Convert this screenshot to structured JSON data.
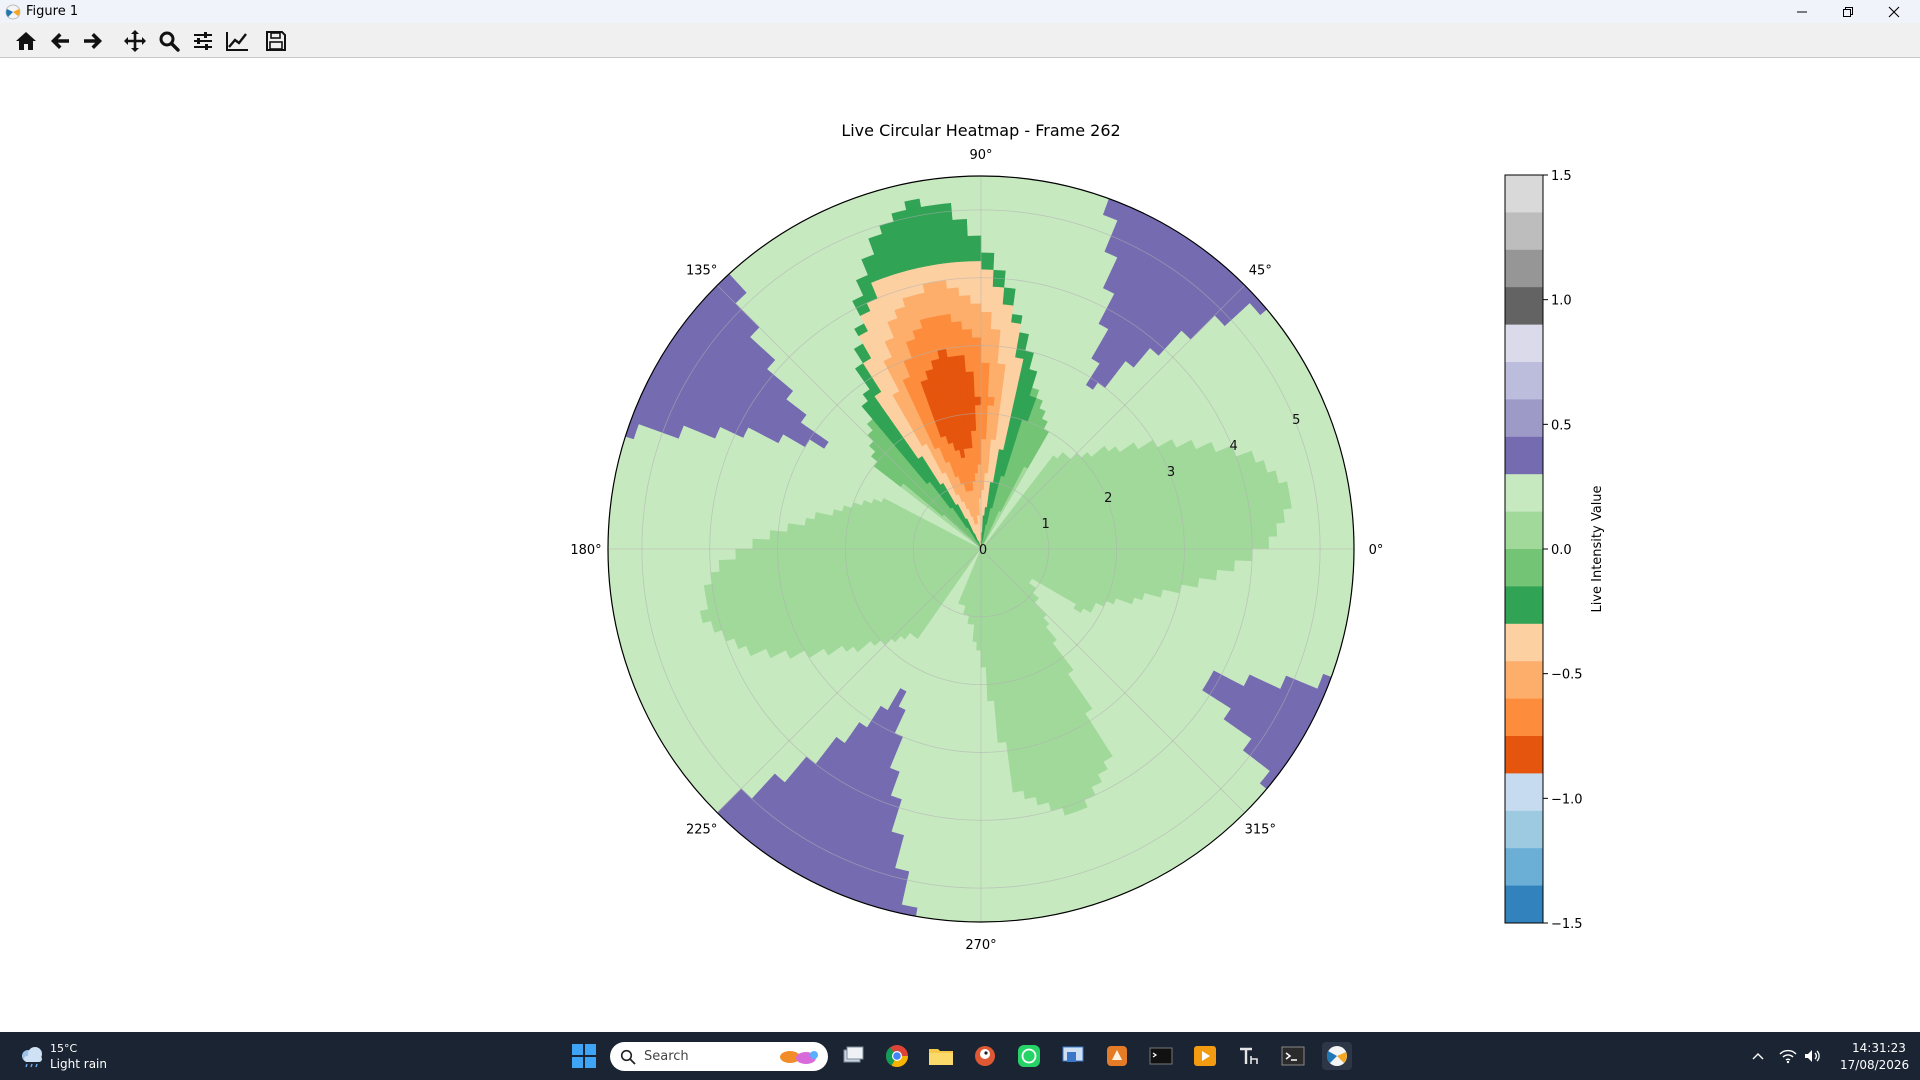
{
  "window": {
    "title": "Figure 1"
  },
  "toolbar": {
    "buttons": [
      {
        "name": "home",
        "icon": "home-icon"
      },
      {
        "name": "back",
        "icon": "arrow-left-icon"
      },
      {
        "name": "forward",
        "icon": "arrow-right-icon"
      },
      {
        "name": "pan",
        "icon": "move-icon"
      },
      {
        "name": "zoom",
        "icon": "magnifier-icon"
      },
      {
        "name": "configure",
        "icon": "sliders-icon"
      },
      {
        "name": "edit-axis",
        "icon": "line-chart-icon"
      },
      {
        "name": "save",
        "icon": "floppy-icon"
      }
    ]
  },
  "chart_data": {
    "type": "heatmap",
    "projection": "polar",
    "title": "Live Circular Heatmap - Frame 262",
    "angle_ticks": [
      "0°",
      "45°",
      "90°",
      "135°",
      "180°",
      "225°",
      "270°",
      "315°"
    ],
    "radial_ticks": [
      "0",
      "1",
      "2",
      "3",
      "4",
      "5"
    ],
    "rlim": [
      0,
      5.5
    ],
    "grid": true,
    "colorbar": {
      "label": "Live Intensity Value",
      "ticks": [
        "1.5",
        "1.0",
        "0.5",
        "0.0",
        "−0.5",
        "−1.0",
        "−1.5"
      ],
      "range": [
        -1.5,
        1.5
      ],
      "colors_top_to_bottom": [
        "#d9d9d9",
        "#bdbdbd",
        "#969696",
        "#636363",
        "#dadaeb",
        "#bcbddc",
        "#9e9ac8",
        "#756bb1",
        "#c7e9c0",
        "#a1d99b",
        "#74c476",
        "#31a354",
        "#fdd0a2",
        "#fdae6b",
        "#fd8d3c",
        "#e6550d",
        "#c6dbef",
        "#9ecae1",
        "#6baed6",
        "#3182bd"
      ]
    },
    "lobes": [
      {
        "angle_deg": 101,
        "r_outer": 5.2,
        "peak_value": -0.9
      },
      {
        "angle_deg": 10,
        "r_outer": 4.6,
        "peak_value": 0.05
      },
      {
        "angle_deg": 193,
        "r_outer": 4.2,
        "peak_value": 0.05
      },
      {
        "angle_deg": 290,
        "r_outer": 4.1,
        "peak_value": 0.1
      }
    ]
  },
  "taskbar": {
    "weather_temp": "15°C",
    "weather_desc": "Light rain",
    "search_placeholder": "Search",
    "time": "14:31:23",
    "date": "17/08/2026"
  }
}
